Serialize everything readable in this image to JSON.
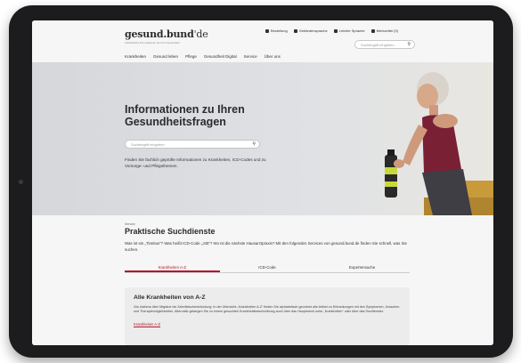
{
  "header": {
    "logo_main": "gesund.bund",
    "logo_tld": "de",
    "tagline": "Verlässliche Informationen für Ihre Gesundheit",
    "utility_links": [
      "Bestellung",
      "Gebärdensprache",
      "Leichte Sprache",
      "Merkzettel (0)"
    ],
    "search_placeholder": "Suchbegriff eingeben"
  },
  "nav": {
    "items": [
      "Krankheiten",
      "Gesund leben",
      "Pflege",
      "Gesundheit Digital",
      "Service",
      "Über uns"
    ]
  },
  "hero": {
    "title": "Informationen zu Ihren Gesundheitsfragen",
    "search_placeholder": "Suchbegriff eingeben",
    "text": "Finden Sie fachlich geprüfte Informationen zu Krankheiten, ICD-Codes und zu Vorsorge- und Pflegethemen."
  },
  "services": {
    "kicker": "Service",
    "title": "Praktische Suchdienste",
    "intro": "Was ist ein „Tinnitus“? Was heißt ICD-Code „J45“? Wo ist die nächste Hausarztpraxis? Mit den folgenden Services von gesund.bund.de finden Sie schnell, was Sie suchen.",
    "tabs": [
      "Krankheiten A-Z",
      "ICD-Code",
      "Expertensuche"
    ],
    "active_tab": 0
  },
  "card": {
    "title": "Alle Krankheiten von A-Z",
    "text": "Von Asthma über Migräne bis Zahnfleischentzündung: In der Übersicht „Krankheiten A-Z“ finden Sie alphabetisch geordnet alle Artikel zu Erkrankungen mit den Symptomen, Ursachen und Therapiemöglichkeiten. Alternativ gelangen Sie zu einem gesuchten Krankheitsbeschreibung auch über das Hauptmenü unter „Krankheiten“ oder über das Suchfenster.",
    "link": "Krankheiten A-Z"
  },
  "colors": {
    "accent": "#b5162b",
    "text": "#2b2b2b",
    "background": "#f6f6f6",
    "device": "#1c1c1e"
  }
}
